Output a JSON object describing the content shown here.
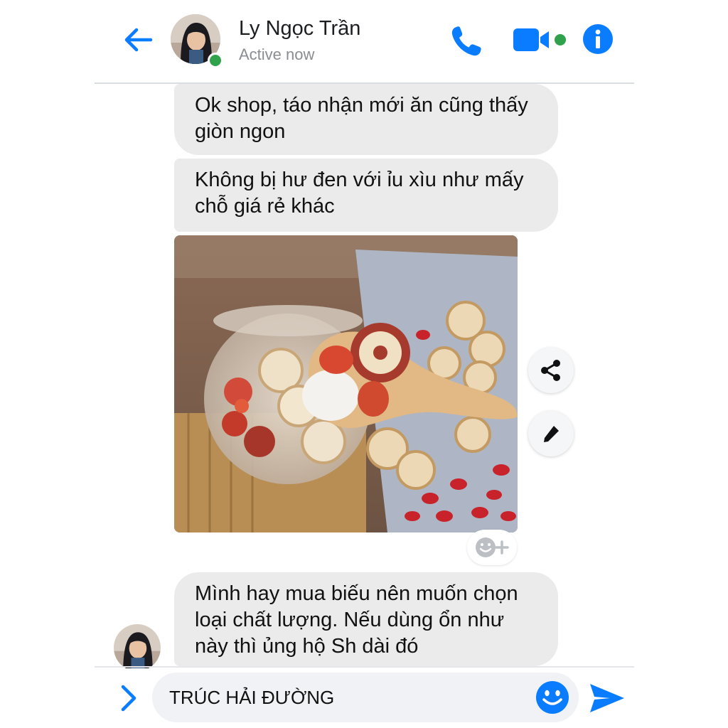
{
  "header": {
    "contact_name": "Ly Ngọc Trần",
    "status": "Active now",
    "icons": {
      "back": "back-arrow-icon",
      "call": "phone-icon",
      "video": "video-camera-icon",
      "info": "info-icon"
    },
    "accent_color": "#0a7cff",
    "online_color": "#31a24c"
  },
  "messages": [
    {
      "text": "Ok shop, táo nhận mới ăn cũng thấy giòn ngon"
    },
    {
      "text": "Không bị hư đen với ỉu xìu như mấy chỗ giá rẻ khác"
    },
    {
      "type": "photo",
      "content": "jujube-and-goji-tea-photo"
    },
    {
      "text": "Mình hay mua biếu nên muốn chọn loại chất lượng. Nếu dùng ổn như này thì ủng hộ Sh dài đó"
    }
  ],
  "photo_actions": {
    "share_icon": "share-icon",
    "edit_icon": "pencil-icon",
    "react_icon": "add-reaction-icon"
  },
  "composer": {
    "value": "TRÚC HẢI ĐƯỜNG",
    "icons": {
      "expand": "chevron-right-icon",
      "emoji": "smiley-icon",
      "send": "send-icon"
    }
  },
  "colors": {
    "bubble": "#ebebeb",
    "composer_bg": "#f0f2f5"
  }
}
